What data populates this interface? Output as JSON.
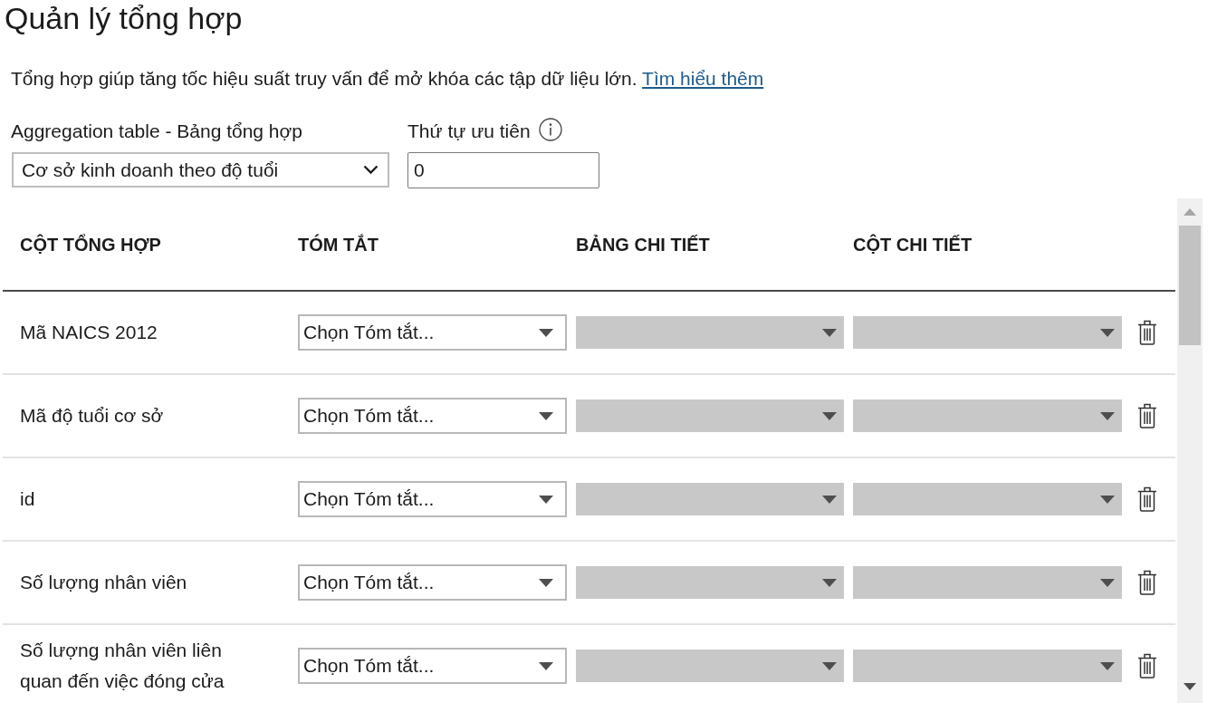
{
  "title": "Quản lý tổng hợp",
  "description": {
    "text": "Tổng hợp giúp tăng tốc hiệu suất truy vấn để mở khóa các tập dữ liệu lớn.",
    "link": "Tìm hiểu thêm"
  },
  "aggregation_table": {
    "label": "Aggregation table - Bảng tổng hợp",
    "value": "Cơ sở kinh doanh theo độ tuổi"
  },
  "priority": {
    "label": "Thứ tự ưu tiên",
    "value": "0"
  },
  "table": {
    "columns": [
      "CỘT TỔNG HỢP",
      "TÓM TẮT",
      "BẢNG CHI TIẾT",
      "CỘT CHI TIẾT"
    ],
    "rows": [
      {
        "column": "Mã NAICS 2012",
        "summary": {
          "text": "Chọn Tóm tắt...",
          "disabled": false
        },
        "detail_table": {
          "disabled": true
        },
        "detail_column": {
          "disabled": true
        }
      },
      {
        "column": "Mã độ tuổi cơ sở",
        "summary": {
          "text": "Chọn Tóm tắt...",
          "disabled": false
        },
        "detail_table": {
          "disabled": true
        },
        "detail_column": {
          "disabled": true
        }
      },
      {
        "column": "id",
        "summary": {
          "text": "Chọn Tóm tắt...",
          "disabled": false
        },
        "detail_table": {
          "disabled": true
        },
        "detail_column": {
          "disabled": true
        }
      },
      {
        "column": "Số lượng nhân viên",
        "summary": {
          "text": "Chọn Tóm tắt...",
          "disabled": false
        },
        "detail_table": {
          "disabled": true
        },
        "detail_column": {
          "disabled": true
        }
      },
      {
        "column": "Số lượng nhân viên liên quan đến việc đóng cửa",
        "summary": {
          "text": "Chọn Tóm tắt...",
          "disabled": false
        },
        "detail_table": {
          "disabled": true
        },
        "detail_column": {
          "disabled": true
        }
      }
    ]
  }
}
